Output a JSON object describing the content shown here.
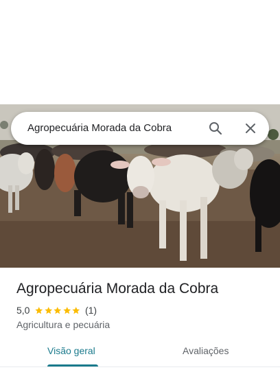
{
  "search": {
    "query": "Agropecuária Morada da Cobra",
    "search_icon": "search-icon",
    "clear_icon": "close-icon"
  },
  "hero": {
    "image": "photo-herd-of-cattle"
  },
  "place": {
    "name": "Agropecuária Morada da Cobra",
    "rating": "5,0",
    "stars": 5,
    "review_count": "(1)",
    "category": "Agricultura e pecuária"
  },
  "tabs": [
    {
      "label": "Visão geral",
      "selected": true
    },
    {
      "label": "Avaliações",
      "selected": false
    }
  ],
  "colors": {
    "accent": "#1a7a8c",
    "star": "#fbbc04"
  }
}
